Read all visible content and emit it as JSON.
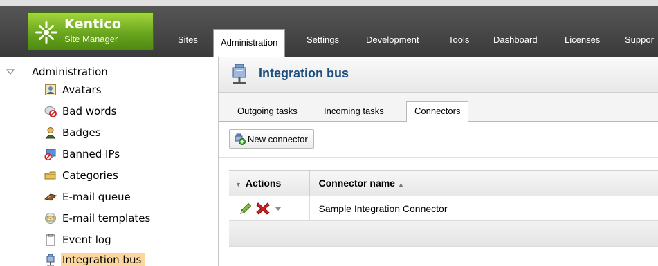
{
  "header": {
    "logo_title": "Kentico",
    "logo_subtitle": "Site Manager",
    "tabs": [
      {
        "label": "Sites"
      },
      {
        "label": "Administration"
      },
      {
        "label": "Settings"
      },
      {
        "label": "Development"
      },
      {
        "label": "Tools"
      },
      {
        "label": "Dashboard"
      },
      {
        "label": "Licenses"
      },
      {
        "label": "Suppor"
      }
    ],
    "active_tab": "Administration"
  },
  "tree": {
    "root_label": "Administration",
    "items": [
      {
        "label": "Avatars",
        "icon": "avatar-icon"
      },
      {
        "label": "Bad words",
        "icon": "bad-words-icon"
      },
      {
        "label": "Badges",
        "icon": "badge-icon"
      },
      {
        "label": "Banned IPs",
        "icon": "banned-ip-icon"
      },
      {
        "label": "Categories",
        "icon": "categories-icon"
      },
      {
        "label": "E-mail queue",
        "icon": "email-queue-icon"
      },
      {
        "label": "E-mail templates",
        "icon": "email-template-icon"
      },
      {
        "label": "Event log",
        "icon": "event-log-icon"
      },
      {
        "label": "Integration bus",
        "icon": "integration-bus-icon"
      }
    ],
    "selected": "Integration bus"
  },
  "main": {
    "title": "Integration bus",
    "subtabs": [
      {
        "label": "Outgoing tasks"
      },
      {
        "label": "Incoming tasks"
      },
      {
        "label": "Connectors"
      }
    ],
    "active_subtab": "Connectors",
    "toolbar": {
      "new_connector_label": "New connector"
    },
    "grid": {
      "columns": [
        "Actions",
        "Connector name"
      ],
      "sort_column": "Connector name",
      "sort_direction": "ascending",
      "rows": [
        {
          "connector_name": "Sample Integration Connector"
        }
      ]
    }
  },
  "colors": {
    "brand_green": "#6aa61f",
    "title_blue": "#1d4f7c",
    "selected_highlight": "#fbd79f",
    "header_dark": "#3a3a3a"
  }
}
